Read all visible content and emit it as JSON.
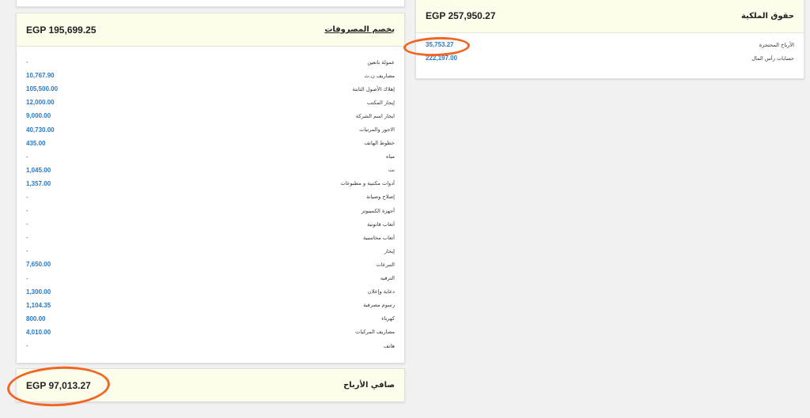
{
  "expenses": {
    "title": "يخصم المصروفات",
    "total": "EGP 195,699.25",
    "items": [
      {
        "label": "عمولة باتعين",
        "value": "-"
      },
      {
        "label": "مصاريف ن.ث",
        "value": "10,767.90"
      },
      {
        "label": "إهلاك الأصول الثابتة",
        "value": "105,500.00"
      },
      {
        "label": "إيجار المكتب",
        "value": "12,000.00"
      },
      {
        "label": "ايجار اسم الشركة",
        "value": "9,000.00"
      },
      {
        "label": "الاجور والمرتبات",
        "value": "40,730.00"
      },
      {
        "label": "خطوط الهاتف",
        "value": "435.00"
      },
      {
        "label": "مياه",
        "value": "-"
      },
      {
        "label": "نت",
        "value": "1,045.00"
      },
      {
        "label": "أدوات مكتبية و مطبوعات",
        "value": "1,357.00"
      },
      {
        "label": "إصلاح وصيانة",
        "value": "-"
      },
      {
        "label": "أجهزة الكمبيوتر",
        "value": "-"
      },
      {
        "label": "أتعاب قانونية",
        "value": "-"
      },
      {
        "label": "أتعاب محاسبية",
        "value": "-"
      },
      {
        "label": "إيجار",
        "value": "-"
      },
      {
        "label": "التبرعات",
        "value": "7,650.00"
      },
      {
        "label": "الترفيه",
        "value": "-"
      },
      {
        "label": "دعاية وإعلان",
        "value": "1,300.00"
      },
      {
        "label": "رسوم مصرفية",
        "value": "1,104.35"
      },
      {
        "label": "كهرباء",
        "value": "800.00"
      },
      {
        "label": "مصاريف المركبات",
        "value": "4,010.00"
      },
      {
        "label": "هاتف",
        "value": "-"
      }
    ]
  },
  "net_profit": {
    "title": "صافي الأرباح",
    "total": "EGP 97,013.27"
  },
  "equity": {
    "title": "حقوق الملكية",
    "total": "EGP 257,950.27",
    "items": [
      {
        "label": "الأرباح المحتجزة",
        "value": "35,753.27"
      },
      {
        "label": "حسابات رأس المال",
        "value": "222,197.00"
      }
    ]
  },
  "colors": {
    "link": "#2878c6",
    "header_bg": "#fdfdec",
    "annotation": "#f26522"
  }
}
